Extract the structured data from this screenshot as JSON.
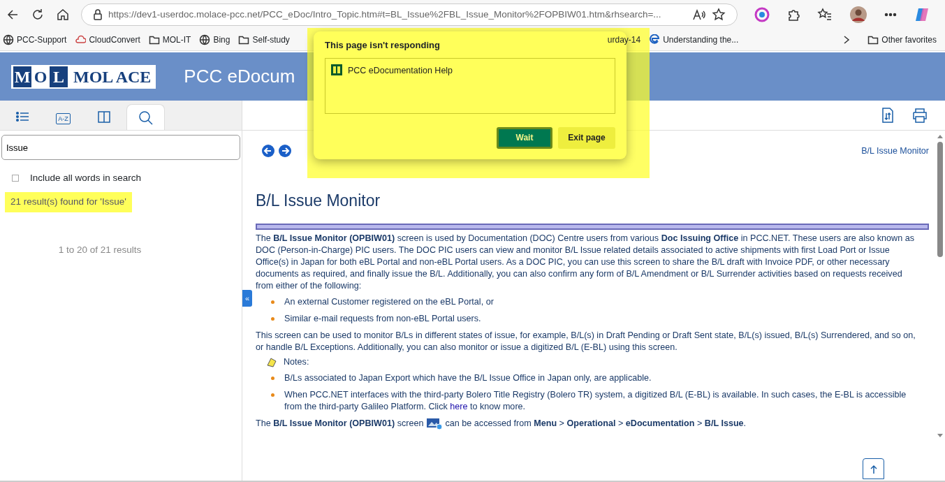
{
  "browser": {
    "address": "https://dev1-userdoc.molace-pcc.net/PCC_eDoc/Intro_Topic.htm#t=BL_Issue%2FBL_Issue_Monitor%2FOPBIW01.htm&rhsearch=...",
    "bookmarks": [
      {
        "kind": "globe",
        "label": "PCC-Support"
      },
      {
        "kind": "cloud",
        "label": "CloudConvert"
      },
      {
        "kind": "folder",
        "label": "MOL-IT"
      },
      {
        "kind": "globe",
        "label": "Bing"
      },
      {
        "kind": "folder",
        "label": "Self-study"
      },
      {
        "kind": "none",
        "label": "urday-14"
      },
      {
        "kind": "edge",
        "label": "Understanding the..."
      }
    ],
    "other_favorites": "Other favorites"
  },
  "header": {
    "logo_letters": [
      "M",
      "O",
      "L"
    ],
    "logo_name": "MOL ACE",
    "title": "PCC eDocum"
  },
  "sidebar": {
    "tabs": [
      {
        "kind": "toc",
        "selected": false
      },
      {
        "kind": "index",
        "label": "A-Z",
        "selected": false
      },
      {
        "kind": "glossary",
        "selected": false
      },
      {
        "kind": "search",
        "selected": true
      }
    ],
    "search_value": "Issue",
    "include_all": {
      "label": "Include all words in search",
      "checked": false
    },
    "result_summary": {
      "text": "21 result(s) found for 'Issue'",
      "highlighted": true
    },
    "pagination": "1 to 20 of 21 results",
    "collapse_label": "«"
  },
  "topic": {
    "breadcrumb": "B/L Issue Monitor",
    "heading": "B/L Issue Monitor",
    "blocks": [
      {
        "kind": "paragraph",
        "text": "The **B/L Issue Monitor (OPBIW01)** screen is used by Documentation (DOC) Centre users from various **Doc Issuing Office** in PCC.NET. These users are also known as DOC (Person-in-Charge) PIC users. The DOC PIC users can view and monitor B/L Issue related details associated to active shipments with first Load Port or Issue Office(s) in Japan for both eBL Portal and non-eBL Portal users. As a DOC PIC, you can use this screen to share the B/L draft with Invoice PDF, or other necessary documents as required, and finally issue the B/L. Additionally, you can also confirm any form of B/L Amendment or B/L Surrender activities based on requests received from either of the following:"
      },
      {
        "kind": "bullets",
        "items": [
          {
            "text": "An external Customer registered on the eBL Portal, or"
          },
          {
            "text": "Similar e-mail requests from non-eBL Portal users."
          }
        ]
      },
      {
        "kind": "paragraph",
        "text": "This screen can be used to monitor B/Ls in different states of issue, for example, B/L(s) in Draft Pending or Draft Sent state, B/L(s) issued, B/L(s) Surrendered, and so on, or handle B/L Exceptions. Additionally, you can also monitor or issue a digitized B/L (E-BL) using this screen."
      },
      {
        "kind": "notes",
        "label": "Notes:"
      },
      {
        "kind": "bullets",
        "items": [
          {
            "text": "B/Ls associated to Japan Export which have the B/L Issue Office in Japan only, are applicable."
          },
          {
            "text": "When PCC.NET interfaces with the third-party Bolero Title Registry (Bolero TR) system, a digitized B/L (E-BL) is available. In such cases, the E-BL is accessible from the third-party Galileo Platform. Click ",
            "link": "here",
            "after": " to know more."
          }
        ]
      },
      {
        "kind": "icon_paragraph",
        "before": "The **B/L Issue Monitor (OPBIW01)** screen ",
        "after": " can be accessed from **Menu** > **Operational** > **eDocumentation** > **B/L Issue**."
      }
    ]
  },
  "dialog": {
    "title": "This page isn't responding",
    "page": "PCC eDocumentation Help",
    "buttons": [
      {
        "label": "Wait",
        "primary": true
      },
      {
        "label": "Exit page",
        "primary": false
      }
    ]
  }
}
